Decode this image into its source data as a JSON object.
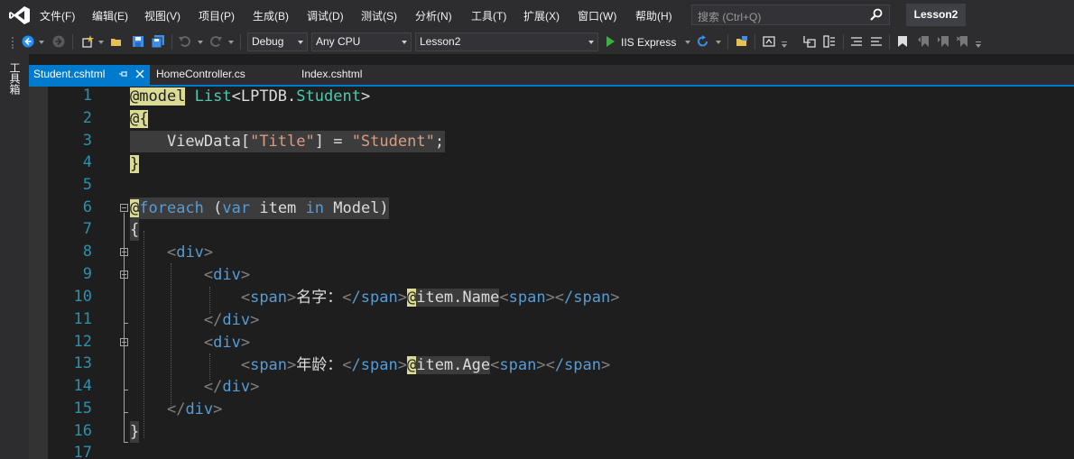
{
  "menu": {
    "items": [
      "文件(F)",
      "编辑(E)",
      "视图(V)",
      "项目(P)",
      "生成(B)",
      "调试(D)",
      "测试(S)",
      "分析(N)",
      "工具(T)",
      "扩展(X)",
      "窗口(W)",
      "帮助(H)"
    ],
    "search_placeholder": "搜索 (Ctrl+Q)",
    "solution_name": "Lesson2"
  },
  "toolbar": {
    "configuration": "Debug",
    "platform": "Any CPU",
    "startup_project": "Lesson2",
    "run_label": "IIS Express"
  },
  "left_dock": {
    "toolbox_label": "工具箱"
  },
  "tabs": [
    {
      "label": "Student.cshtml",
      "active": true
    },
    {
      "label": "HomeController.cs",
      "active": false
    },
    {
      "label": "Index.cshtml",
      "active": false
    }
  ],
  "editor": {
    "line_numbers": [
      "1",
      "2",
      "3",
      "4",
      "5",
      "6",
      "7",
      "8",
      "9",
      "10",
      "11",
      "12",
      "13",
      "14",
      "15",
      "16",
      "17"
    ],
    "code": {
      "l1": {
        "at": "@model",
        "type": "List",
        "generic": "<LPTDB.",
        "cls": "Student",
        "close": ">"
      },
      "l2": {
        "at": "@{"
      },
      "l3": {
        "a": "ViewData[",
        "s1": "\"Title\"",
        "b": "] = ",
        "s2": "\"Student\"",
        "c": ";"
      },
      "l4": {
        "brace": "}"
      },
      "l6": {
        "at": "@",
        "kw": "foreach",
        "p1": " (",
        "var": "var",
        "rest": " item ",
        "in": "in",
        "model": " Model)"
      },
      "l7": {
        "brace": "{"
      },
      "l8": {
        "lt": "<",
        "tag": "div",
        "gt": ">"
      },
      "l9": {
        "lt": "<",
        "tag": "div",
        "gt": ">"
      },
      "l10": {
        "open": "span",
        "text": "名字：",
        "close": "/span",
        "at": "@",
        "expr": "item",
        "prop": ".Name",
        "open2": "span",
        "close2": "/span"
      },
      "l11": {
        "lt": "</",
        "tag": "div",
        "gt": ">"
      },
      "l12": {
        "lt": "<",
        "tag": "div",
        "gt": ">"
      },
      "l13": {
        "open": "span",
        "text": "年龄：",
        "close": "/span",
        "at": "@",
        "expr": "item",
        "prop": ".Age",
        "open2": "span",
        "close2": "/span"
      },
      "l14": {
        "lt": "</",
        "tag": "div",
        "gt": ">"
      },
      "l15": {
        "lt": "</",
        "tag": "div",
        "gt": ">"
      },
      "l16": {
        "brace": "}"
      }
    }
  },
  "colors": {
    "accent": "#007acc",
    "keyword": "#569cd6",
    "type": "#4ec9b0",
    "string": "#d69d85",
    "razor_highlight": "#dbdb95",
    "line_number": "#2b91af"
  }
}
